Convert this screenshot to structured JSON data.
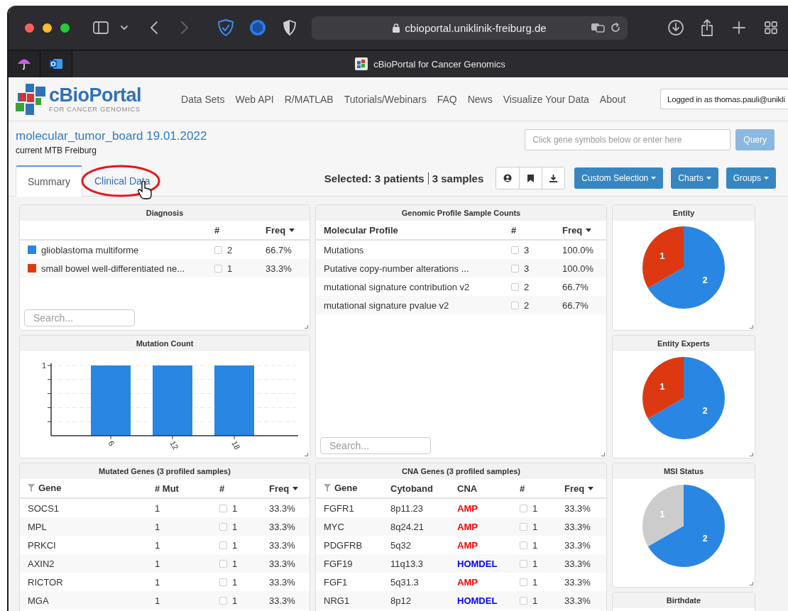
{
  "browser": {
    "url": "cbioportal.uniklinik-freiburg.de",
    "tab_title": "cBioPortal for Cancer Genomics"
  },
  "header": {
    "logo_title": "cBioPortal",
    "logo_subtitle": "FOR CANCER GENOMICS",
    "nav": [
      "Data Sets",
      "Web API",
      "R/MATLAB",
      "Tutorials/Webinars",
      "FAQ",
      "News",
      "Visualize Your Data",
      "About"
    ],
    "login": "Logged in as thomas.pauli@unikli"
  },
  "study": {
    "title": "molecular_tumor_board 19.01.2022",
    "subtitle": "current MTB Freiburg",
    "gene_query": {
      "placeholder": "Click gene symbols below or enter here"
    },
    "query_button": {
      "label": "Query",
      "disabled": true
    }
  },
  "tabs": [
    {
      "label": "Summary",
      "selected": true,
      "circled": false
    },
    {
      "label": "Clinical Data",
      "selected": false,
      "circled": true
    }
  ],
  "selection": [
    "Selected: 3 patients",
    "3 samples"
  ],
  "toolbar_buttons": [
    "Custom Selection",
    "Charts",
    "Groups"
  ],
  "cards": [
    {
      "kind": "table",
      "title": "Diagnosis",
      "columns": [
        null,
        "#",
        {
          "label": "Freq",
          "sorted": true
        }
      ],
      "rows": [
        {
          "color": "#2986e2",
          "label": "glioblastoma multiforme",
          "checked": false,
          "count": "2",
          "freq": "66.7%"
        },
        {
          "color": "#dc3912",
          "label": "small bowel well-differentiated ne...",
          "checked": false,
          "count": "1",
          "freq": "33.3%"
        }
      ],
      "search": {
        "placeholder": "Search..."
      }
    },
    {
      "kind": "table",
      "title": "Genomic Profile Sample Counts",
      "columns": [
        "Molecular Profile",
        "#",
        {
          "label": "Freq",
          "sorted": true
        }
      ],
      "rows": [
        {
          "label": "Mutations",
          "checked": false,
          "count": "3",
          "freq": "100.0%"
        },
        {
          "label": "Putative copy-number alterations ...",
          "checked": false,
          "count": "3",
          "freq": "100.0%"
        },
        {
          "label": "mutational signature contribution v2",
          "checked": false,
          "count": "2",
          "freq": "66.7%"
        },
        {
          "label": "mutational signature pvalue v2",
          "checked": false,
          "count": "2",
          "freq": "66.7%"
        }
      ],
      "search": {
        "placeholder": "Search..."
      }
    },
    {
      "kind": "chart",
      "title": "Entity",
      "chart_data": {
        "type": "pie",
        "data_labels": true,
        "values": [
          2,
          1
        ],
        "colors": [
          "#2986e2",
          "#dc3912"
        ]
      }
    },
    {
      "kind": "chart",
      "title": "Mutation Count",
      "chart_data": {
        "type": "bar",
        "categories": [
          "6",
          "12",
          "18"
        ],
        "ylim": [
          0,
          1
        ],
        "yticks": [
          1
        ],
        "series": [
          {
            "color": "#2986e2",
            "values": [
              1,
              1,
              1
            ]
          }
        ]
      }
    },
    {
      "kind": "chart",
      "title": "Entity Experts",
      "chart_data": {
        "type": "pie",
        "data_labels": true,
        "values": [
          2,
          1
        ],
        "colors": [
          "#2986e2",
          "#dc3912"
        ]
      }
    },
    {
      "kind": "table",
      "title": "Mutated Genes (3 profiled samples)",
      "columns": [
        {
          "label": "Gene",
          "filter": true
        },
        "# Mut",
        "#",
        {
          "label": "Freq",
          "sorted": true
        }
      ],
      "rows": [
        {
          "gene": "SOCS1",
          "mut": "1",
          "checked": false,
          "count": "1",
          "freq": "33.3%"
        },
        {
          "gene": "MPL",
          "mut": "1",
          "checked": false,
          "count": "1",
          "freq": "33.3%"
        },
        {
          "gene": "PRKCI",
          "mut": "1",
          "checked": false,
          "count": "1",
          "freq": "33.3%"
        },
        {
          "gene": "AXIN2",
          "mut": "1",
          "checked": false,
          "count": "1",
          "freq": "33.3%"
        },
        {
          "gene": "RICTOR",
          "mut": "1",
          "checked": false,
          "count": "1",
          "freq": "33.3%"
        },
        {
          "gene": "MGA",
          "mut": "1",
          "checked": false,
          "count": "1",
          "freq": "33.3%"
        }
      ]
    },
    {
      "kind": "table",
      "title": "CNA Genes (3 profiled samples)",
      "columns": [
        {
          "label": "Gene",
          "filter": true
        },
        "Cytoband",
        "CNA",
        "#",
        {
          "label": "Freq",
          "sorted": true
        }
      ],
      "rows": [
        {
          "gene": "FGFR1",
          "cytoband": "8p11.23",
          "cna": {
            "text": "AMP",
            "color": "#ff0000"
          },
          "checked": false,
          "count": "1",
          "freq": "33.3%"
        },
        {
          "gene": "MYC",
          "cytoband": "8q24.21",
          "cna": {
            "text": "AMP",
            "color": "#ff0000"
          },
          "checked": false,
          "count": "1",
          "freq": "33.3%"
        },
        {
          "gene": "PDGFRB",
          "cytoband": "5q32",
          "cna": {
            "text": "AMP",
            "color": "#ff0000"
          },
          "checked": false,
          "count": "1",
          "freq": "33.3%"
        },
        {
          "gene": "FGF19",
          "cytoband": "11q13.3",
          "cna": {
            "text": "HOMDEL",
            "color": "#0000ff"
          },
          "checked": false,
          "count": "1",
          "freq": "33.3%"
        },
        {
          "gene": "FGF1",
          "cytoband": "5q31.3",
          "cna": {
            "text": "AMP",
            "color": "#ff0000"
          },
          "checked": false,
          "count": "1",
          "freq": "33.3%"
        },
        {
          "gene": "NRG1",
          "cytoband": "8p12",
          "cna": {
            "text": "HOMDEL",
            "color": "#0000ff"
          },
          "checked": false,
          "count": "1",
          "freq": "33.3%"
        }
      ]
    },
    {
      "kind": "chart",
      "title": "MSI Status",
      "chart_data": {
        "type": "pie",
        "data_labels": true,
        "values": [
          2,
          1
        ],
        "colors": [
          "#2986e2",
          "#cccccc"
        ]
      }
    },
    {
      "kind": "empty",
      "title": "Birthdate"
    }
  ]
}
